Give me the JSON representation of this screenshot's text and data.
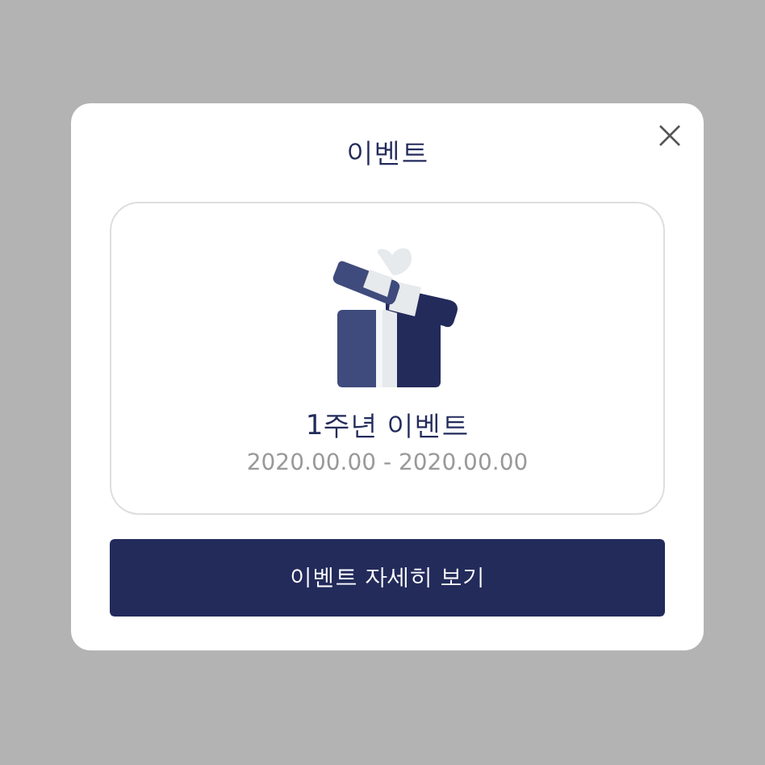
{
  "dialog": {
    "title": "이벤트"
  },
  "event": {
    "name": "1주년 이벤트",
    "period": "2020.00.00 - 2020.00.00"
  },
  "button": {
    "label": "이벤트 자세히 보기"
  }
}
